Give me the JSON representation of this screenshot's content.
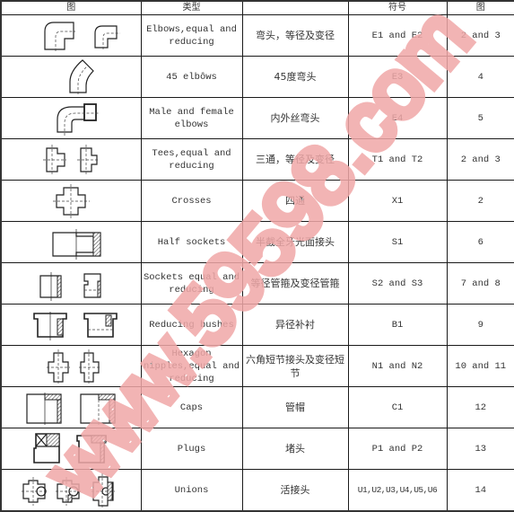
{
  "table": {
    "headers": [
      "图",
      "类型",
      "",
      "符号",
      "图"
    ],
    "rows": [
      {
        "icon": "elbow-fitting-icon",
        "type_en": "Elbows,equal and reducing",
        "type_zh": "弯头，等径及变径",
        "symbol": "E1 and E2",
        "figure": "2 and 3"
      },
      {
        "icon": "45-degree-elbow-icon",
        "type_en": "45 elbôws",
        "type_zh": "45度弯头",
        "symbol": "E3",
        "figure": "4"
      },
      {
        "icon": "male-female-elbow-icon",
        "type_en": "Male and female elbows",
        "type_zh": "内外丝弯头",
        "symbol": "E4",
        "figure": "5"
      },
      {
        "icon": "tee-fitting-icon",
        "type_en": "Tees,equal and reducing",
        "type_zh": "三通，等径及变径",
        "symbol": "T1 and T2",
        "figure": "2 and 3"
      },
      {
        "icon": "cross-fitting-icon",
        "type_en": "Crosses",
        "type_zh": "四通",
        "symbol": "X1",
        "figure": "2"
      },
      {
        "icon": "half-socket-icon",
        "type_en": "Half sockets",
        "type_zh": "半截全牙光面接头",
        "symbol": "S1",
        "figure": "6"
      },
      {
        "icon": "socket-icon",
        "type_en": "Sockets equal and reducing",
        "type_zh": "等径管箍及变径管箍",
        "symbol": "S2 and S3",
        "figure": "7 and 8"
      },
      {
        "icon": "reducing-bush-icon",
        "type_en": "Reducing bushes",
        "type_zh": "异径补衬",
        "symbol": "B1",
        "figure": "9"
      },
      {
        "icon": "hexagon-nipple-icon",
        "type_en": "Hexagon nipples,equal and reducing",
        "type_zh": "六角短节接头及变径短节",
        "symbol": "N1 and N2",
        "figure": "10 and 11"
      },
      {
        "icon": "cap-icon",
        "type_en": "Caps",
        "type_zh": "管帽",
        "symbol": "C1",
        "figure": "12"
      },
      {
        "icon": "plug-icon",
        "type_en": "Plugs",
        "type_zh": "堵头",
        "symbol": "P1 and P2",
        "figure": "13"
      },
      {
        "icon": "union-icon",
        "type_en": "Unions",
        "type_zh": "活接头",
        "symbol": "U1,U2,U3,U4,U5,U6",
        "figure": "14"
      }
    ]
  },
  "watermark": {
    "text": "www.59598.com",
    "color": "#f0a8a8"
  }
}
